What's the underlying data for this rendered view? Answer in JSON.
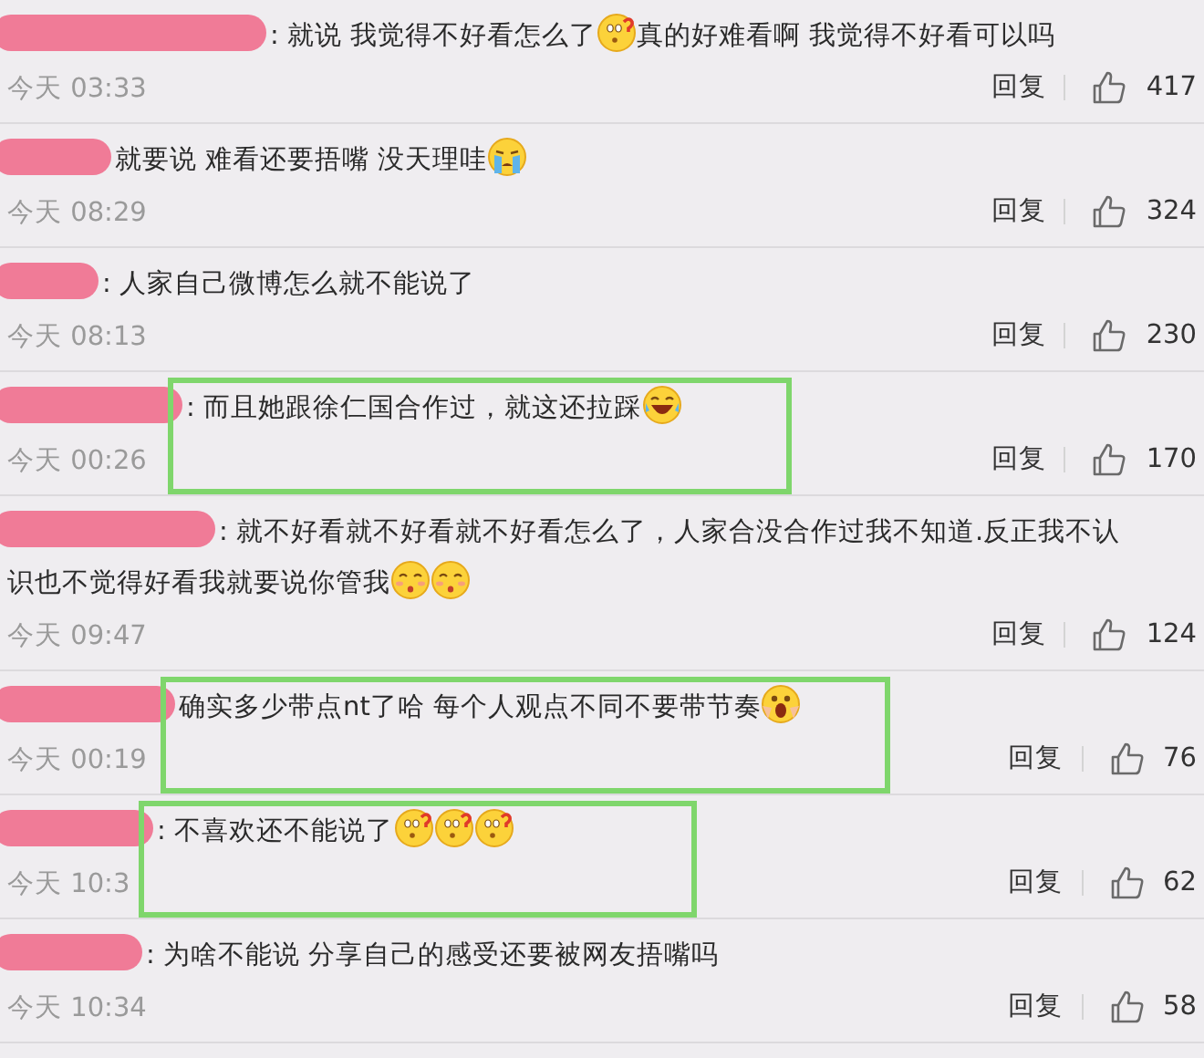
{
  "comments": [
    {
      "highlighted": false,
      "segments": [
        {
          "kind": "text",
          "text": ": 就说 我觉得不好看怎么了"
        },
        {
          "kind": "confused"
        },
        {
          "kind": "text",
          "text": "真的好难看啊 我觉得不好看可以吗"
        }
      ],
      "time": "今天 03:33",
      "reply": "回复",
      "likes": "417"
    },
    {
      "highlighted": false,
      "segments": [
        {
          "kind": "text",
          "text": "就要说 难看还要捂嘴 没天理哇"
        },
        {
          "kind": "crying"
        }
      ],
      "time": "今天 08:29",
      "reply": "回复",
      "likes": "324"
    },
    {
      "highlighted": false,
      "segments": [
        {
          "kind": "text",
          "text": ": 人家自己微博怎么就不能说了"
        }
      ],
      "time": "今天 08:13",
      "reply": "回复",
      "likes": "230"
    },
    {
      "highlighted": true,
      "segments": [
        {
          "kind": "text",
          "text": ": 而且她跟徐仁国合作过，就这还拉踩"
        },
        {
          "kind": "laughing"
        }
      ],
      "time": "今天 00:26",
      "reply": "回复",
      "likes": "170"
    },
    {
      "highlighted": false,
      "segments": [
        {
          "kind": "text",
          "text": ": 就不好看就不好看就不好看怎么了，人家合没合作过我不知道.反正我不认"
        },
        {
          "kind": "break"
        },
        {
          "kind": "text",
          "text": "识也不觉得好看我就要说你管我"
        },
        {
          "kind": "kissing"
        },
        {
          "kind": "kissing"
        }
      ],
      "time": "今天 09:47",
      "reply": "回复",
      "likes": "124"
    },
    {
      "highlighted": true,
      "segments": [
        {
          "kind": "text",
          "text": "确实多少带点nt了哈 每个人观点不同不要带节奏"
        },
        {
          "kind": "screaming"
        }
      ],
      "time": "今天 00:19",
      "reply": "回复",
      "likes": "76"
    },
    {
      "highlighted": true,
      "segments": [
        {
          "kind": "text",
          "text": ": 不喜欢还不能说了"
        },
        {
          "kind": "confused"
        },
        {
          "kind": "confused"
        },
        {
          "kind": "confused"
        }
      ],
      "time": "今天 10:3",
      "reply": "回复",
      "likes": "62"
    },
    {
      "highlighted": false,
      "segments": [
        {
          "kind": "text",
          "text": ": 为啥不能说 分享自己的感受还要被网友捂嘴吗"
        }
      ],
      "time": "今天 10:34",
      "reply": "回复",
      "likes": "58"
    }
  ]
}
